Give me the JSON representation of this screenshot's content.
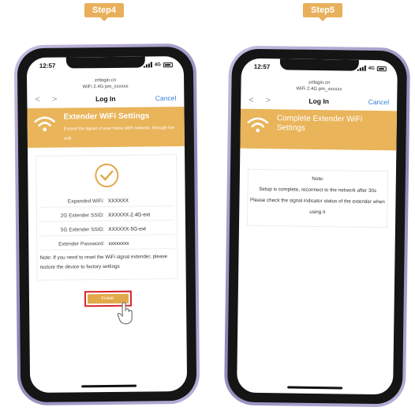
{
  "steps": {
    "step4": "Step4",
    "step5": "Step5"
  },
  "statusbar": {
    "time": "12:57",
    "network": "4G"
  },
  "browser": {
    "domain": "zrtlogin.cn",
    "wifi_name": "WiFi 2.4G pm_xxxxxx",
    "page_title": "Log In",
    "cancel_label": "Cancel",
    "back_arrows": "< >"
  },
  "screen1": {
    "banner_title": "Extender WiFi Settings",
    "banner_desc": "Extend the signal of your home WiFi network, through the wall",
    "rows": [
      {
        "label": "Expanded WiFi:",
        "value": "XXXXXX"
      },
      {
        "label": "2G Extender SSID:",
        "value": "XXXXXX-2.4G-ext"
      },
      {
        "label": "5G Extender SSID:",
        "value": "XXXXXX-5G-ext"
      },
      {
        "label": "Extender Password:",
        "value": "xxxxxxxx"
      }
    ],
    "note": "Note: If you need to reset the WiFi signal extender, please restore the device to factory settings",
    "finish_label": "Finish"
  },
  "screen2": {
    "banner_title": "Complete Extender WiFi Settings",
    "note_title": "Note:",
    "note_line1": "Setup is complete, reconnect to the network after 30s",
    "note_line2": "Please check the signal indicator status of the extender when using it"
  },
  "colors": {
    "accent": "#e9b45a",
    "link": "#3a82d8",
    "highlight": "#d6242a",
    "phone_frame": "#9d92c4"
  }
}
